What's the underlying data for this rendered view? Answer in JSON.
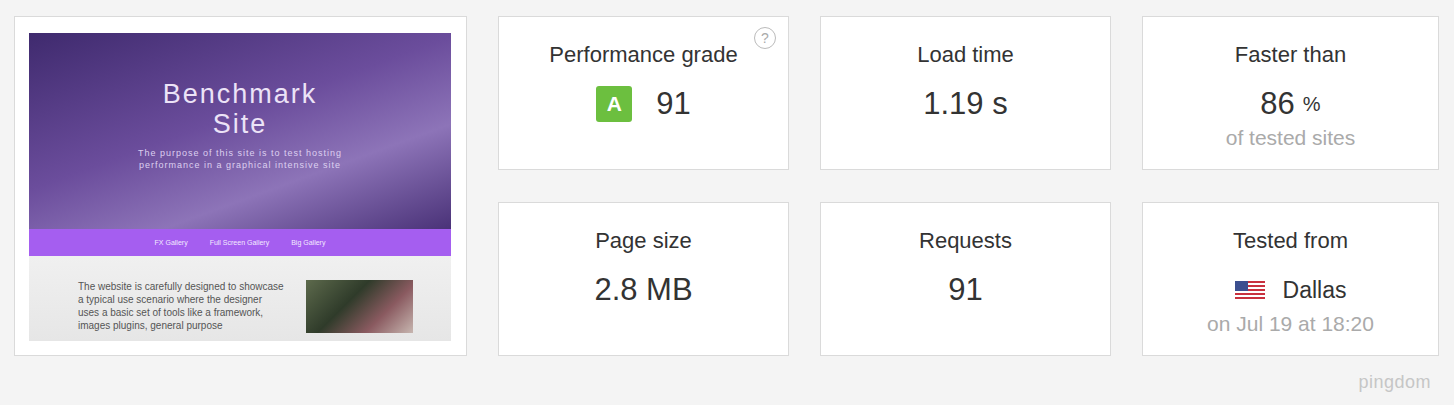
{
  "preview": {
    "title": "Benchmark Site",
    "subtitle": "The purpose of this site is to test hosting performance in a graphical intensive site",
    "nav": [
      "FX Gallery",
      "Full Screen Gallery",
      "Big Gallery"
    ],
    "body": "The website is carefully designed to showcase a typical use scenario where the designer uses a basic set of tools like a framework, images plugins, general purpose"
  },
  "stats": [
    {
      "kind": "grade",
      "label": "Performance grade",
      "badge": "A",
      "value": "91",
      "help": "?"
    },
    {
      "kind": "value",
      "label": "Load time",
      "value": "1.19 s"
    },
    {
      "kind": "percent",
      "label": "Faster than",
      "value": "86",
      "unit": "%",
      "note": "of tested sites"
    },
    {
      "kind": "value",
      "label": "Page size",
      "value": "2.8 MB"
    },
    {
      "kind": "value",
      "label": "Requests",
      "value": "91"
    },
    {
      "kind": "location",
      "label": "Tested from",
      "value": "Dallas",
      "note": "on Jul 19 at 18:20"
    }
  ],
  "logo": "pingdom"
}
